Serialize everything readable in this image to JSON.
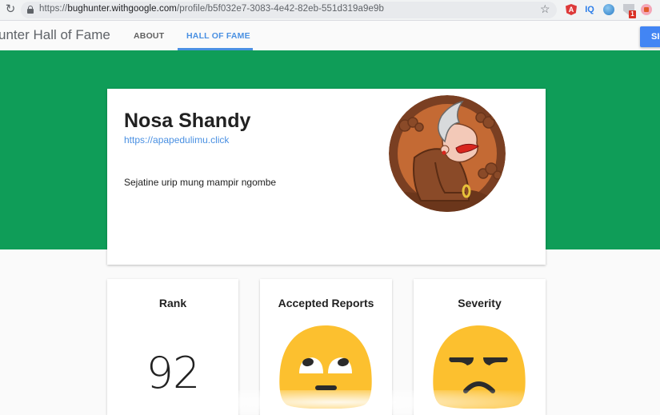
{
  "browser": {
    "url_scheme": "https://",
    "url_host": "bughunter.withgoogle.com",
    "url_path": "/profile/b5f032e7-3083-4e42-82eb-551d319a9e9b",
    "extension_badge": "1",
    "extension_iq_label": "IQ"
  },
  "header": {
    "title": "unter Hall of Fame",
    "tabs": [
      {
        "label": "ABOUT",
        "active": false
      },
      {
        "label": "HALL OF FAME",
        "active": true
      }
    ],
    "signin_label": "SIGN IN"
  },
  "profile": {
    "name": "Nosa Shandy",
    "website": "https://apapedulimu.click",
    "bio": "Sejatine urip mung mampir ngombe",
    "avatar": "wayang-semar-illustration"
  },
  "stats": [
    {
      "label": "Rank",
      "value": "92"
    },
    {
      "label": "Accepted Reports",
      "icon": "face-with-rolling-eyes-emoji"
    },
    {
      "label": "Severity",
      "icon": "unamused-face-emoji"
    }
  ],
  "colors": {
    "banner_green": "#0f9d58",
    "accent_blue": "#4a90e2",
    "signin_blue": "#4285f4",
    "emoji_yellow": "#fcc02f"
  }
}
